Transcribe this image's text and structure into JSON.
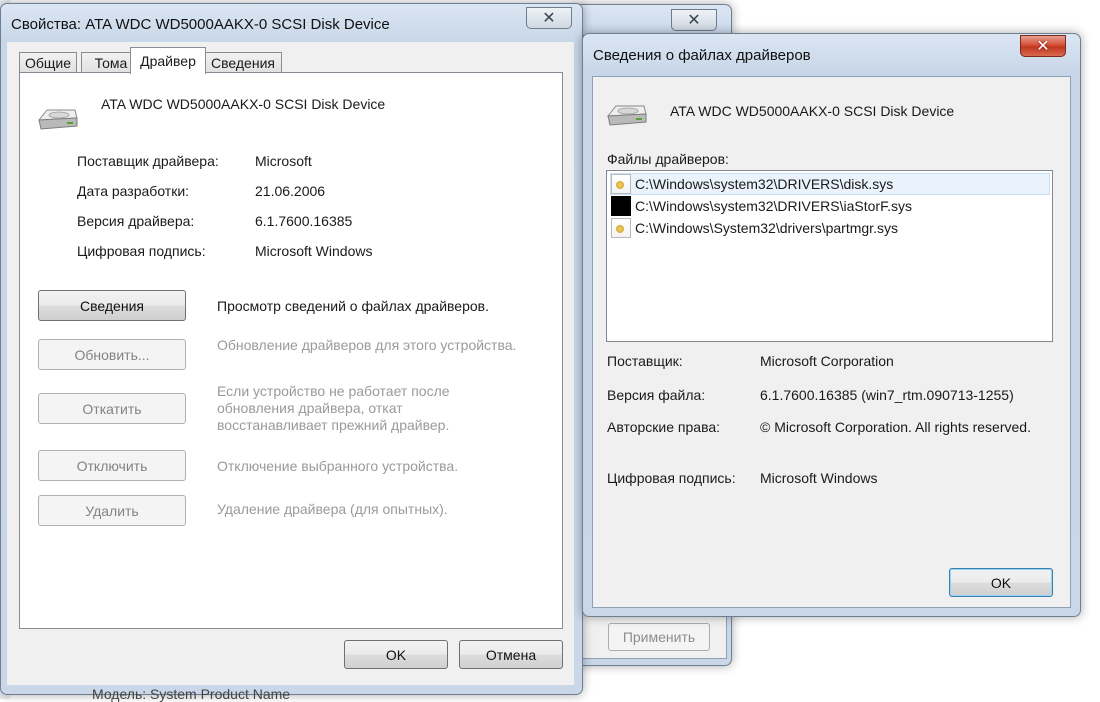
{
  "background": {
    "bottom_text": "Модель: System Product Name"
  },
  "back_window": {
    "apply_button": "Применить",
    "close_glyph": "✕"
  },
  "properties_window": {
    "title": "Свойства: ATA WDC WD5000AAKX-0 SCSI Disk Device",
    "close_glyph": "✕",
    "tabs": [
      {
        "label": "Общие",
        "active": false
      },
      {
        "label": "Тома",
        "active": false
      },
      {
        "label": "Драйвер",
        "active": true
      },
      {
        "label": "Сведения",
        "active": false
      }
    ],
    "device_name": "ATA WDC WD5000AAKX-0 SCSI Disk Device",
    "fields": [
      {
        "label": "Поставщик драйвера:",
        "value": "Microsoft"
      },
      {
        "label": "Дата разработки:",
        "value": "21.06.2006"
      },
      {
        "label": "Версия драйвера:",
        "value": "6.1.7600.16385"
      },
      {
        "label": "Цифровая подпись:",
        "value": "Microsoft Windows"
      }
    ],
    "actions": [
      {
        "button": "Сведения",
        "description": "Просмотр сведений о файлах драйверов.",
        "enabled": true
      },
      {
        "button": "Обновить...",
        "description": "Обновление драйверов для этого устройства.",
        "enabled": false
      },
      {
        "button": "Откатить",
        "description": "Если устройство не работает после обновления драйвера, откат восстанавливает прежний драйвер.",
        "enabled": false
      },
      {
        "button": "Отключить",
        "description": "Отключение выбранного устройства.",
        "enabled": false
      },
      {
        "button": "Удалить",
        "description": "Удаление драйвера (для опытных).",
        "enabled": false
      }
    ],
    "ok_button": "OK",
    "cancel_button": "Отмена"
  },
  "driver_files_window": {
    "title": "Сведения о файлах драйверов",
    "close_glyph": "✕",
    "device_name": "ATA WDC WD5000AAKX-0 SCSI Disk Device",
    "files_label": "Файлы драйверов:",
    "files": [
      {
        "path": "C:\\Windows\\system32\\DRIVERS\\disk.sys",
        "icon": "certificate-icon",
        "selected": true
      },
      {
        "path": "C:\\Windows\\system32\\DRIVERS\\iaStorF.sys",
        "icon": "black-file-icon",
        "selected": false
      },
      {
        "path": "C:\\Windows\\System32\\drivers\\partmgr.sys",
        "icon": "certificate-icon",
        "selected": false
      }
    ],
    "fields": [
      {
        "label": "Поставщик:",
        "value": "Microsoft Corporation"
      },
      {
        "label": "Версия файла:",
        "value": "6.1.7600.16385 (win7_rtm.090713-1255)"
      },
      {
        "label": "Авторские права:",
        "value": "© Microsoft Corporation. All rights reserved."
      },
      {
        "label": "Цифровая подпись:",
        "value": "Microsoft Windows"
      }
    ],
    "ok_button": "OK"
  }
}
